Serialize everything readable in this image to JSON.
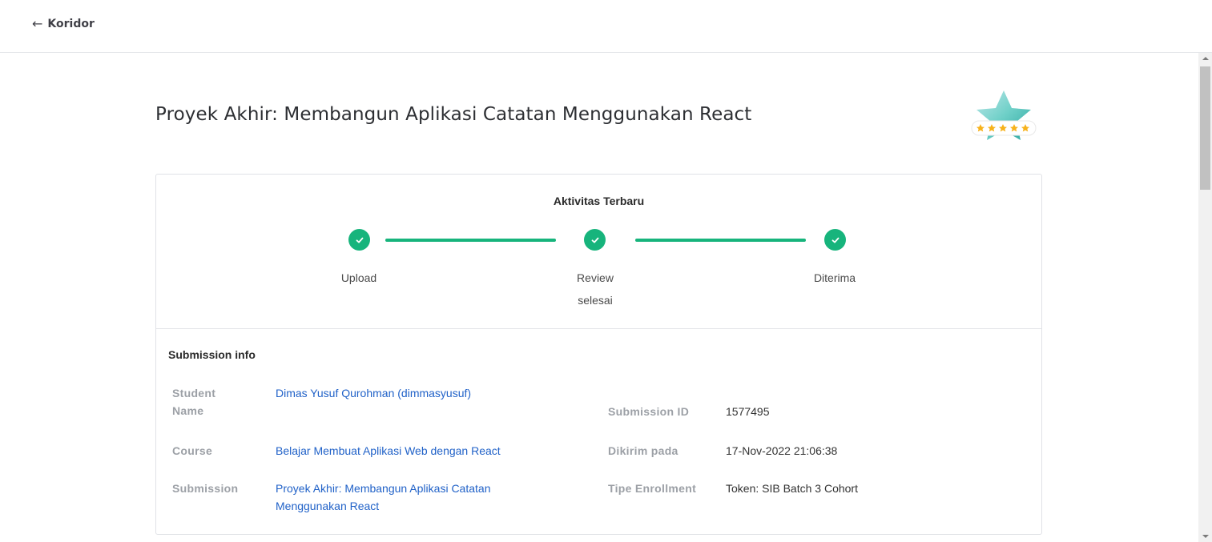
{
  "header": {
    "back_arrow": "←",
    "back_label": "Koridor"
  },
  "page": {
    "title": "Proyek Akhir: Membangun Aplikasi Catatan Menggunakan React",
    "badge_icon": "star-rating-badge"
  },
  "activity": {
    "title": "Aktivitas Terbaru",
    "steps": [
      {
        "label_line1": "Upload",
        "label_line2": "",
        "status": "done"
      },
      {
        "label_line1": "Review",
        "label_line2": "selesai",
        "status": "done"
      },
      {
        "label_line1": "Diterima",
        "label_line2": "",
        "status": "done"
      }
    ]
  },
  "submission_info": {
    "title": "Submission info",
    "student_name_label_line1": "Student",
    "student_name_label_line2": "Name",
    "student_name_value": "Dimas Yusuf Qurohman (dimmasyusuf)",
    "course_label": "Course",
    "course_value": "Belajar Membuat Aplikasi Web dengan React",
    "submission_label": "Submission",
    "submission_value_line1": "Proyek Akhir: Membangun Aplikasi Catatan",
    "submission_value_line2": "Menggunakan React",
    "submission_id_label": "Submission ID",
    "submission_id_value": "1577495",
    "sent_at_label": "Dikirim pada",
    "sent_at_value": "17-Nov-2022 21:06:38",
    "enrollment_label": "Tipe Enrollment",
    "enrollment_value": "Token: SIB Batch 3 Cohort"
  },
  "colors": {
    "accent_green": "#17b47c",
    "link_blue": "#2162c8",
    "label_gray": "#9ca0a6"
  }
}
